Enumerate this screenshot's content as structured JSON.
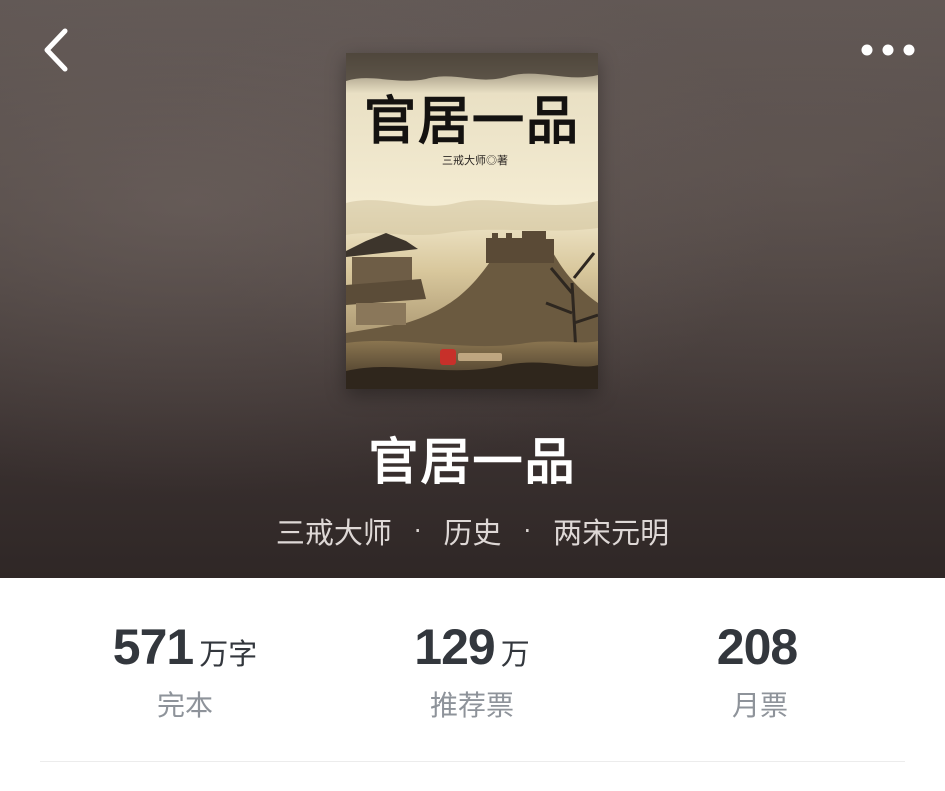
{
  "header": {
    "back_icon": "chevron-left-icon",
    "more_icon": "more-horizontal-icon"
  },
  "book": {
    "cover": {
      "title": "官居一品",
      "author_credit": "三戒大师◎著"
    },
    "title": "官居一品",
    "author": "三戒大师",
    "category": "历史",
    "subcategory": "两宋元明",
    "separator": "·"
  },
  "stats": [
    {
      "value": "571",
      "unit": "万字",
      "label": "完本"
    },
    {
      "value": "129",
      "unit": "万",
      "label": "推荐票"
    },
    {
      "value": "208",
      "unit": "",
      "label": "月票"
    }
  ],
  "colors": {
    "hero_background": "#4c4340",
    "stat_number": "#33373d",
    "stat_label": "#8e939a"
  }
}
